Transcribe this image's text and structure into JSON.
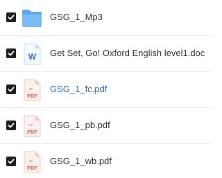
{
  "files": [
    {
      "name": "GSG_1_Mp3",
      "type": "folder",
      "icon": "folder-icon",
      "checked": true,
      "highlighted": false
    },
    {
      "name": "Get Set, Go! Oxford English level1.doc",
      "type": "doc",
      "icon": "word-doc-icon",
      "icon_letter": "W",
      "checked": true,
      "highlighted": false
    },
    {
      "name": "GSG_1_fc.pdf",
      "type": "pdf",
      "icon": "pdf-icon",
      "icon_letter": "PDF",
      "checked": true,
      "highlighted": true
    },
    {
      "name": "GSG_1_pb.pdf",
      "type": "pdf",
      "icon": "pdf-icon",
      "icon_letter": "PDF",
      "checked": true,
      "highlighted": false
    },
    {
      "name": "GSG_1_wb.pdf",
      "type": "pdf",
      "icon": "pdf-icon",
      "icon_letter": "PDF",
      "checked": true,
      "highlighted": false
    }
  ],
  "colors": {
    "text": "#333333",
    "link": "#2d6bc8",
    "checkbox": "#1f1f1f",
    "folder": "#5ea7ee",
    "word": "#2b6ed9",
    "pdf": "#e8584d"
  }
}
